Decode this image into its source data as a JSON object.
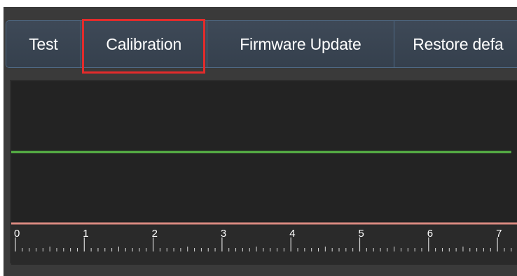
{
  "tabs": [
    {
      "label": "Test"
    },
    {
      "label": "Calibration"
    },
    {
      "label": "Firmware Update"
    },
    {
      "label": "Restore defa"
    }
  ],
  "colors": {
    "tab_background": "#3a4553",
    "tab_border": "#4f6a86",
    "chart_background": "#232323",
    "signal_line": "#5ab947",
    "baseline": "#d88a80",
    "highlight_border": "#e32b2b"
  },
  "chart_data": {
    "type": "line",
    "xlim": [
      0,
      7.2
    ],
    "x_tick_labels": [
      "0",
      "1",
      "2",
      "3",
      "4",
      "5",
      "6",
      "7"
    ],
    "minor_ticks_per_unit": 10,
    "series": [
      {
        "color": "#5ab947",
        "x": [
          0,
          7.2
        ],
        "y": [
          1,
          1
        ]
      }
    ],
    "baseline_color": "#d88a80",
    "grid": false
  }
}
